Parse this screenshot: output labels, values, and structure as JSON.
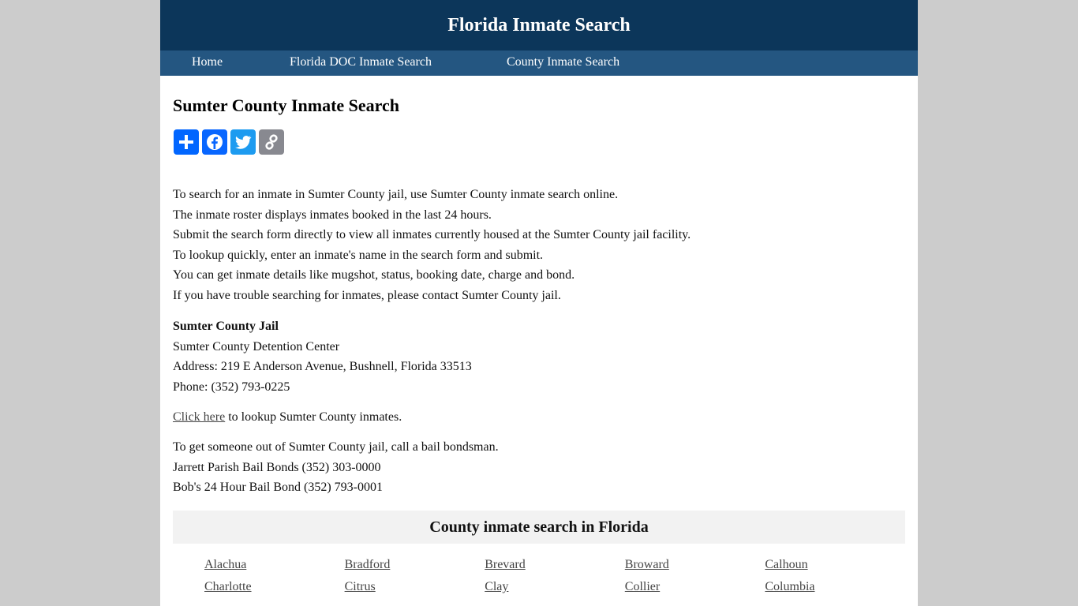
{
  "site": {
    "title": "Florida Inmate Search"
  },
  "nav": {
    "items": [
      {
        "label": "Home"
      },
      {
        "label": "Florida DOC Inmate Search"
      },
      {
        "label": "County Inmate Search"
      }
    ]
  },
  "page": {
    "title": "Sumter County Inmate Search"
  },
  "share": {
    "buttons": [
      {
        "name": "share",
        "icon": "plus-icon",
        "color": "#0166ff"
      },
      {
        "name": "facebook",
        "icon": "facebook-icon",
        "color": "#0866ff"
      },
      {
        "name": "twitter",
        "icon": "twitter-icon",
        "color": "#1d9bf0"
      },
      {
        "name": "copy-link",
        "icon": "link-icon",
        "color": "#888990"
      }
    ]
  },
  "intro": {
    "lines": [
      "To search for an inmate in Sumter County jail, use Sumter County inmate search online.",
      "The inmate roster displays inmates booked in the last 24 hours.",
      "Submit the search form directly to view all inmates currently housed at the Sumter County jail facility.",
      "To lookup quickly, enter an inmate's name in the search form and submit.",
      "You can get inmate details like mugshot, status, booking date, charge and bond.",
      "If you have trouble searching for inmates, please contact Sumter County jail."
    ]
  },
  "jail": {
    "name": "Sumter County Jail",
    "facility": "Sumter County Detention Center",
    "address": "Address: 219 E Anderson Avenue, Bushnell, Florida 33513",
    "phone": "Phone: (352) 793-0225"
  },
  "lookup": {
    "link_label": "Click here",
    "rest": " to lookup Sumter County inmates."
  },
  "bail": {
    "lines": [
      "To get someone out of Sumter County jail, call a bail bondsman.",
      "Jarrett Parish Bail Bonds (352) 303-0000",
      "Bob's 24 Hour Bail Bond (352) 793-0001"
    ]
  },
  "counties": {
    "heading": "County inmate search in Florida",
    "items": [
      "Alachua",
      "Bradford",
      "Brevard",
      "Broward",
      "Calhoun",
      "Charlotte",
      "Citrus",
      "Clay",
      "Collier",
      "Columbia"
    ]
  }
}
